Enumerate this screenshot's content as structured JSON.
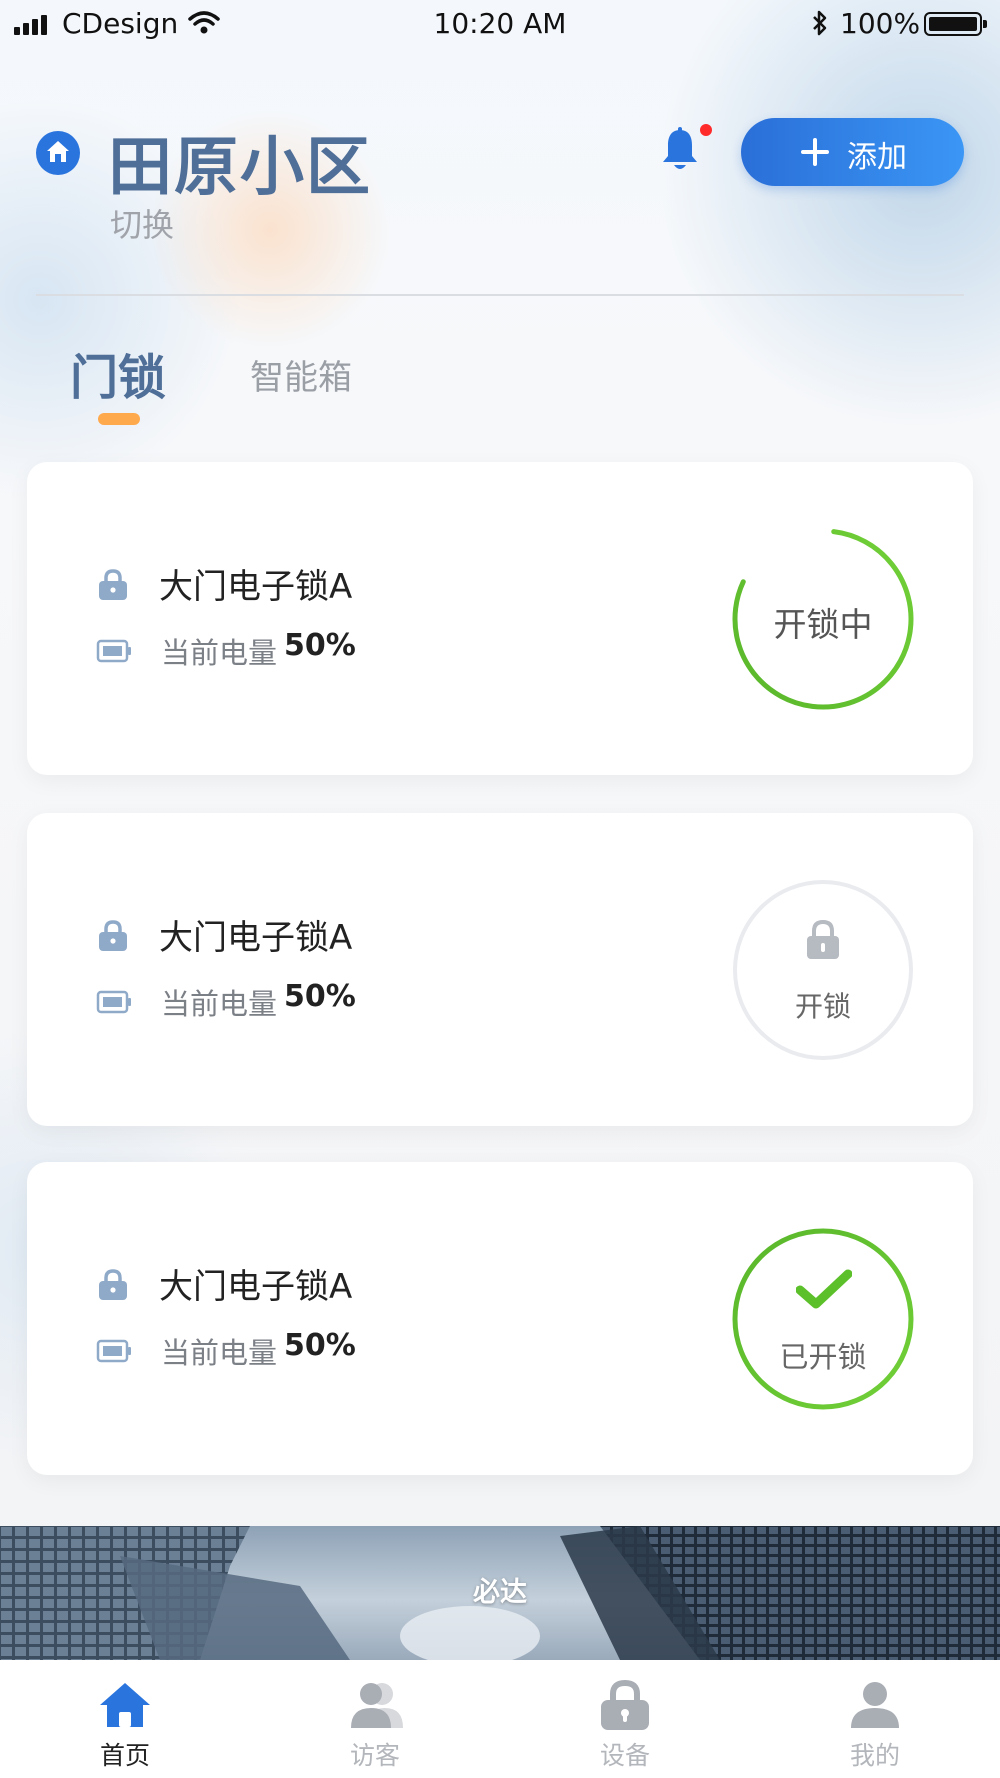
{
  "status_bar": {
    "carrier": "CDesign",
    "time": "10:20 AM",
    "battery_percent": "100%",
    "battery_level": 1.0
  },
  "header": {
    "community_name": "田原小区",
    "switch_label": "切换",
    "add_button_label": "添加",
    "has_notification": true
  },
  "tabs": [
    {
      "label": "门锁",
      "active": true
    },
    {
      "label": "智能箱",
      "active": false
    }
  ],
  "locks": [
    {
      "name": "大门电子锁A",
      "battery_label": "当前电量",
      "battery_value": "50%",
      "action_label": "开锁中",
      "state": "unlocking",
      "progress": 0.8
    },
    {
      "name": "大门电子锁A",
      "battery_label": "当前电量",
      "battery_value": "50%",
      "action_label": "开锁",
      "state": "locked"
    },
    {
      "name": "大门电子锁A",
      "battery_label": "当前电量",
      "battery_value": "50%",
      "action_label": "已开锁",
      "state": "unlocked"
    }
  ],
  "banner": {
    "text": "必达"
  },
  "tabbar": [
    {
      "label": "首页",
      "icon": "home-icon",
      "active": true
    },
    {
      "label": "访客",
      "icon": "visitors-icon",
      "active": false
    },
    {
      "label": "设备",
      "icon": "device-lock-icon",
      "active": false
    },
    {
      "label": "我的",
      "icon": "profile-icon",
      "active": false
    }
  ],
  "colors": {
    "primary_blue": "#2a74de",
    "title_blue": "#4f6f98",
    "accent_orange": "#ffa94d",
    "success_green": "#5cc02a",
    "notification_red": "#ff2a2a"
  }
}
